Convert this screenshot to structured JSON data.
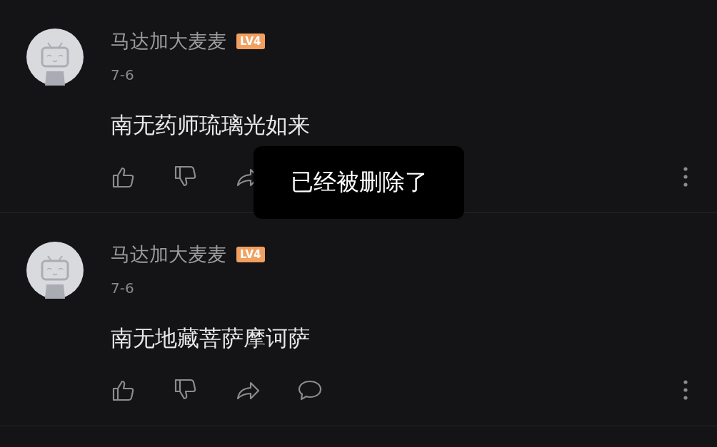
{
  "comments": [
    {
      "user": "马达加大麦麦",
      "level_badge": "LV4",
      "date": "7-6",
      "text": "南无药师琉璃光如来",
      "actions": [
        {
          "kind": "like"
        },
        {
          "kind": "dislike"
        },
        {
          "kind": "share"
        }
      ]
    },
    {
      "user": "马达加大麦麦",
      "level_badge": "LV4",
      "date": "7-6",
      "text": "南无地藏菩萨摩诃萨",
      "actions": [
        {
          "kind": "like"
        },
        {
          "kind": "dislike"
        },
        {
          "kind": "share"
        },
        {
          "kind": "reply"
        }
      ]
    }
  ],
  "toast": {
    "text": "已经被删除了"
  }
}
